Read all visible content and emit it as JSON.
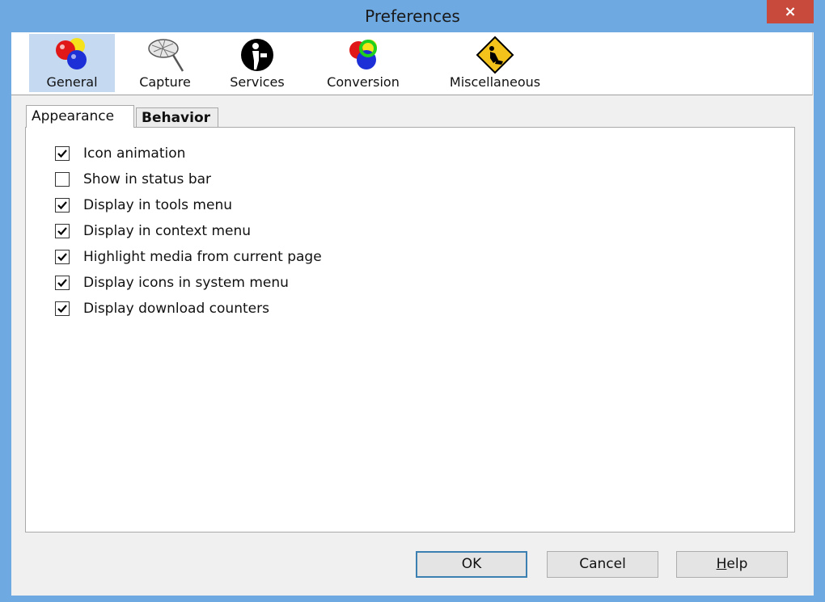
{
  "window": {
    "title": "Preferences",
    "close_glyph": "×"
  },
  "toolbar": [
    {
      "label": "General",
      "icon": "colored-balls-icon",
      "active": true
    },
    {
      "label": "Capture",
      "icon": "net-icon",
      "active": false
    },
    {
      "label": "Services",
      "icon": "person-sign-icon",
      "active": false
    },
    {
      "label": "Conversion",
      "icon": "conversion-balls-icon",
      "active": false
    },
    {
      "label": "Miscellaneous",
      "icon": "construction-sign-icon",
      "active": false
    }
  ],
  "tabs": [
    {
      "label": "Appearance",
      "selected": true
    },
    {
      "label": "Behavior",
      "selected": false
    }
  ],
  "options": [
    {
      "label": "Icon animation",
      "checked": true
    },
    {
      "label": "Show in status bar",
      "checked": false
    },
    {
      "label": "Display in tools menu",
      "checked": true
    },
    {
      "label": "Display in context menu",
      "checked": true
    },
    {
      "label": "Highlight media from current page",
      "checked": true
    },
    {
      "label": "Display icons in system menu",
      "checked": true
    },
    {
      "label": "Display download counters",
      "checked": true
    }
  ],
  "buttons": {
    "ok": "OK",
    "cancel": "Cancel",
    "help_mnemonic": "H",
    "help_rest": "elp"
  },
  "colors": {
    "frame": "#6ea9e2",
    "close": "#c74a3c",
    "active_tool": "#c5d9f1",
    "default_button_border": "#3c7fb1"
  }
}
